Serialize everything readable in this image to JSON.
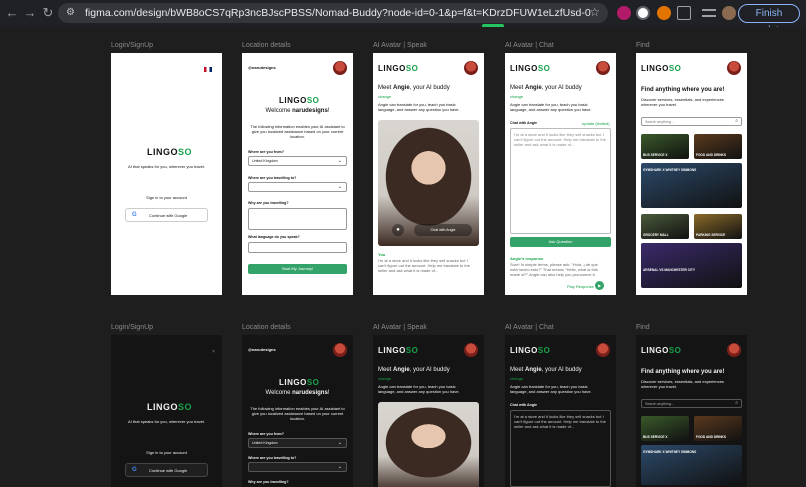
{
  "browser": {
    "url": "figma.com/design/bWB8oCS7qRp3ncBJscPBSS/Nomad-Buddy?node-id=0-1&p=f&t=KDrzDFUW1eLzfUsd-0",
    "finish_update": "Finish update"
  },
  "labels": {
    "login": "Login/SignUp",
    "location": "Location details",
    "speak": "AI Avatar | Speak",
    "chat": "AI Avatar | Chat",
    "find": "Find"
  },
  "brand": {
    "lingo": "LINGO",
    "so": "SO"
  },
  "login": {
    "tagline": "AI that speaks for you, wherever you travel.",
    "sign_in": "Sign in to your account",
    "google": "Continue with Google"
  },
  "location": {
    "handle": "@narudesigns",
    "welcome": "Welcome ",
    "name": "narudesigns",
    "bang": "!",
    "intro": "The following information enables your AI assistant to give you localized assistance based on your current location.",
    "q_from": "Where are you from?",
    "from_value": "United Kingdom",
    "q_to": "Where are you travelling to?",
    "q_why": "Why are you travelling?",
    "q_lang": "What language do you speak?",
    "start": "Start My Journey!"
  },
  "speak": {
    "meet": "Meet ",
    "angie": "Angie",
    "buddy": ", your AI buddy",
    "change": "change",
    "desc": "Angie can translate for you, teach you basic language, and answer any question you have.",
    "chat_with": "Chat with Angie",
    "you": "You",
    "transcript": "I'm at a store and it looks like they sell snacks but I can't figure out the amount. Help me translate to the seller and ask what it is made of..."
  },
  "chat": {
    "chat_with": "Chat with Angie",
    "update": "update (limited)",
    "message": "I'm at a store and it looks like they sell snacks but I can't figure out the amount. Help me translate to the seller and ask what it is made of...",
    "ask": "Ask Question",
    "response_label": "Angie's response",
    "response": "Sure! In simple terms, please ask: \"Hola, ¿de qué está hecho esto?\" That means \"Hello, what is this made of?\" Angie can also help you pronounce it.",
    "play": "Play Response"
  },
  "find": {
    "title": "Find anything where you are!",
    "desc": "Discover services, essentials, and experiences wherever you travel.",
    "search_placeholder": "Search anything...",
    "tiles": [
      "BUS SERVICE X",
      "FOOD AND DRINKS",
      "GYMSHARK X WHITNEY SIMMONS",
      "GROCERY MALL",
      "PARKING SERVICE",
      "ARSENAL VS MANCHESTER CITY"
    ],
    "tile_colors": [
      "#3a5a2a",
      "#5a3a1e",
      "#2c4a6a",
      "#4a5a3a",
      "#8a6a2a",
      "#3a2a6a"
    ]
  }
}
